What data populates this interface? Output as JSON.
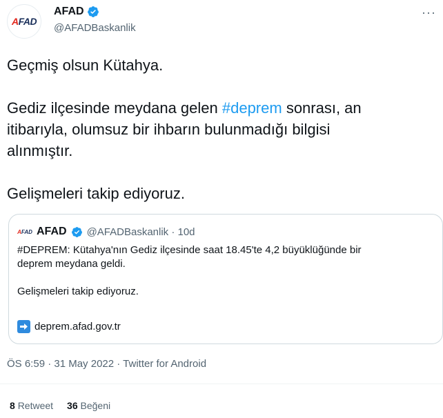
{
  "author": {
    "display_name": "AFAD",
    "handle": "@AFADBaskanlik",
    "avatar_logo": "AFAD",
    "verified": true
  },
  "tweet": {
    "lines": [
      "Geçmiş olsun Kütahya.",
      "Gediz ilçesinde meydana gelen ",
      "#deprem",
      " sonrası, an",
      "itibarıyla, olumsuz bir ihbarın bulunmadığı bilgisi",
      "alınmıştır.",
      "Gelişmeleri takip ediyoruz."
    ]
  },
  "quote": {
    "display_name": "AFAD",
    "handle_time": "@AFADBaskanlik · 10d",
    "avatar_logo": "AFAD",
    "text_line1": "#DEPREM: Kütahya'nın Gediz ilçesinde saat 18.45'te 4,2 büyüklüğünde bir",
    "text_line2": "deprem meydana geldi.",
    "text_line3": "Gelişmeleri takip ediyoruz.",
    "link_icon": "arrow-right-icon",
    "link_text": "deprem.afad.gov.tr"
  },
  "timestamp": "ÖS 6:59 · 31 May 2022 · Twitter for Android",
  "stats": {
    "retweets_count": "8",
    "retweets_label": "Retweet",
    "likes_count": "36",
    "likes_label": "Beğeni"
  },
  "colors": {
    "accent": "#1d9bf0",
    "text": "#0f1419",
    "muted": "#536471",
    "logo_red": "#e2261c",
    "logo_navy": "#1a2f5a"
  }
}
